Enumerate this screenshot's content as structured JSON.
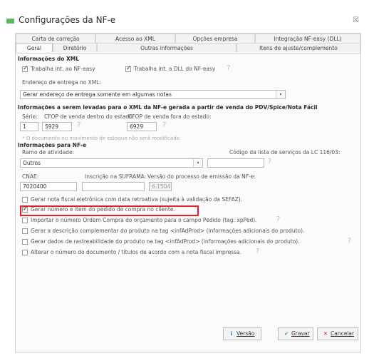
{
  "window": {
    "title": "Configurações da NF-e",
    "close_glyph": "☒"
  },
  "tabs_top": [
    {
      "label": "Carta de correção"
    },
    {
      "label": "Acesso ao XML"
    },
    {
      "label": "Opções empresa"
    },
    {
      "label": "Integração NF-easy (DLL)"
    }
  ],
  "tabs_bottom": [
    {
      "label": "Geral"
    },
    {
      "label": "Diretório"
    },
    {
      "label": "Outras informações"
    },
    {
      "label": "Itens de ajuste/complemento"
    }
  ],
  "xml_section": {
    "title": "Informações do XML",
    "check1": "Trabalha int. ao NF-easy",
    "check2": "Trabalha int. a DLL do NF-easy",
    "address_label": "Endereço de entrega no XML:",
    "address_value": "Gerar endereço de entrega somente em algumas notas"
  },
  "pdv_section": {
    "title": "Informações a serem levadas para o XML da NF-e gerada a partir de venda do PDV/Spice/Nota Fácil",
    "serie_label": "Série:",
    "cfop_in_label": "CFOP de venda dentro do estado:",
    "cfop_out_label": "CFOP de venda fora do estado:",
    "serie_value": "1",
    "cfop_in_value": "5929",
    "cfop_out_value": "6929",
    "note": "* O documento no movimento de estoque não será modificado."
  },
  "nfe_section": {
    "title": "Informações para NF-e",
    "ramo_label": "Ramo de atividade:",
    "ramo_value": "Outros",
    "lc_label": "Código da lista de serviços da LC 116/03:",
    "lc_value": "",
    "cnae_label": "CNAE:",
    "cnae_value": "7020400",
    "suframa_label": "Inscrição na SUFRAMA:",
    "suframa_value": "",
    "versao_label": "Versão do processo de emissão da NF-e:",
    "versao_value": "6.1504"
  },
  "options": [
    {
      "label": "Gerar nota fiscal eletrônica com data retroativa (sujeita à validação da SEFAZ).",
      "checked": false
    },
    {
      "label": "Gerar número e item do pedido de compra no cliente.",
      "checked": true
    },
    {
      "label": "Importar o número Ordem Compra do orçamento para o campo Pedido (tag: xpPed).",
      "checked": false
    },
    {
      "label": "Gerar a descrição complementar do produto na tag <infAdProd> (informações adicionais do produto).",
      "checked": false
    },
    {
      "label": "Gerar dados de rastreabilidade do produto na tag <infAdProd> (informações adicionais do produto).",
      "checked": false
    },
    {
      "label": "Alterar o número do documento / títulos de acordo com a nota fiscal impressa.",
      "checked": false
    }
  ],
  "help_glyph": "?",
  "buttons": {
    "versao": "Versão",
    "gravar": "Gravar",
    "cancelar": "Cancelar"
  },
  "colors": {
    "accent_green": "#5cb85c",
    "highlight_red": "#e2202b"
  }
}
